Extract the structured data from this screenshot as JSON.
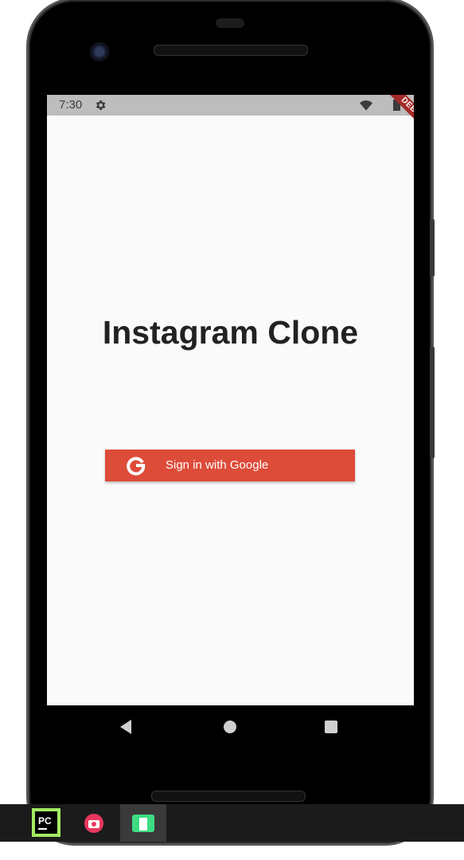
{
  "statusbar": {
    "time": "7:30",
    "debug_label": "DEBUG"
  },
  "main": {
    "title": "Instagram Clone",
    "google_button_label": "Sign in with Google"
  },
  "icons": {
    "status": [
      "gear-icon",
      "wifi-icon",
      "battery-icon"
    ],
    "nav": [
      "back-icon",
      "home-icon",
      "recents-icon"
    ],
    "taskbar": [
      "pycharm-icon",
      "screenshot-icon",
      "emulator-icon"
    ]
  },
  "colors": {
    "google_red": "#dd4b39",
    "debug_red": "#a52a2a",
    "screen_bg": "#fafafa",
    "statusbar_bg": "#bdbdbd"
  }
}
